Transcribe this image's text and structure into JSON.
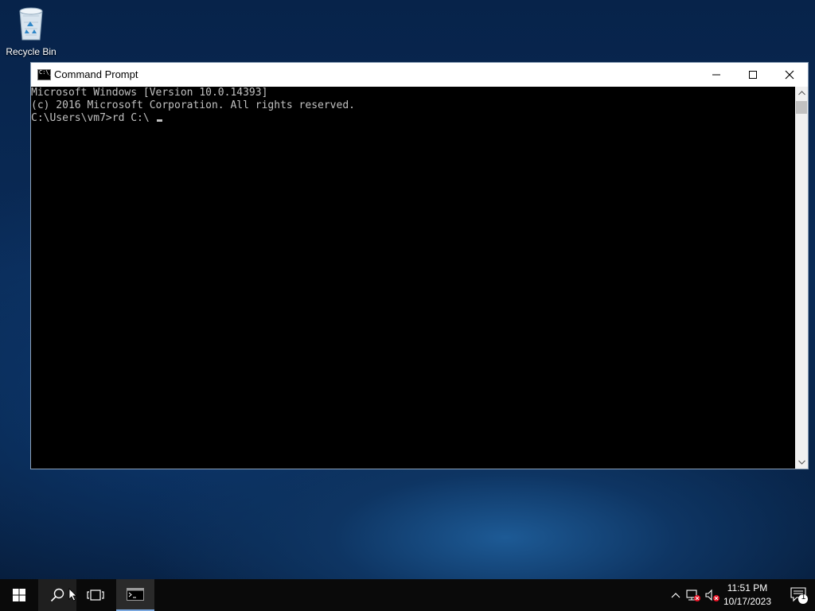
{
  "desktop": {
    "icons": [
      {
        "label": "Recycle Bin",
        "icon": "recycle-bin-icon"
      }
    ]
  },
  "window": {
    "title": "Command Prompt",
    "app_icon": "command-prompt-icon",
    "app_icon_text": "C:\\_",
    "controls": {
      "minimize": "minimize-icon",
      "maximize": "maximize-icon",
      "close": "close-icon"
    }
  },
  "console": {
    "lines": [
      "Microsoft Windows [Version 10.0.14393]",
      "(c) 2016 Microsoft Corporation. All rights reserved.",
      "",
      "C:\\Users\\vm7>rd C:\\ "
    ]
  },
  "taskbar": {
    "start_icon": "windows-start-icon",
    "search_icon": "search-icon",
    "task_view_icon": "task-view-icon",
    "pinned_app_icon": "command-prompt-icon",
    "tray": {
      "icons": [
        "chevron-up-icon",
        "network-error-icon",
        "volume-muted-icon"
      ],
      "time": "11:51 PM",
      "date": "10/17/2023",
      "notification_count": "1"
    }
  },
  "colors": {
    "console_bg": "#000000",
    "console_fg": "#c0c0c0",
    "taskbar_bg": "#0a0a0a",
    "accent": "#7aa7de"
  }
}
